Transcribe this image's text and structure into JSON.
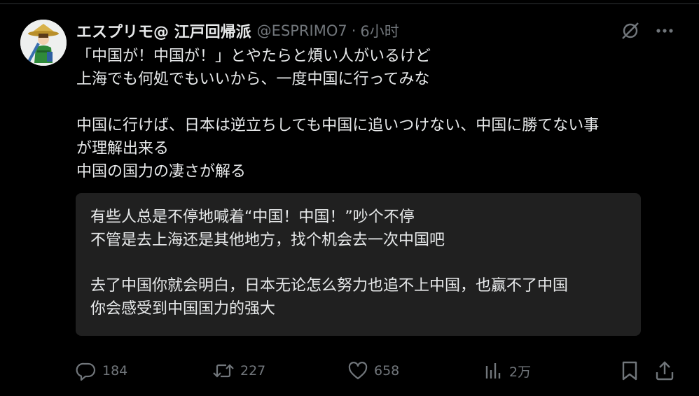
{
  "author": {
    "display_name": "エスプリモ@ 江戸回帰派",
    "handle": "@ESPRIMO7",
    "separator": "·",
    "time": "6小时"
  },
  "icons": {
    "grok": "grok-icon",
    "more": "more-dots-icon",
    "reply": "reply-icon",
    "retweet": "retweet-icon",
    "like": "heart-icon",
    "views": "views-bar-chart-icon",
    "bookmark": "bookmark-icon",
    "share": "share-icon"
  },
  "tweet": {
    "lines": [
      "「中国が！中国が！」とやたらと煩い人がいるけど",
      "上海でも何処でもいいから、一度中国に行ってみな",
      "中国に行けば、日本は逆立ちしても中国に追いつけない、中国に勝てない事",
      "が理解出来る",
      "中国の国力の凄さが解る"
    ]
  },
  "translation": {
    "lines": [
      "有些人总是不停地喊着“中国！中国！”吵个不停",
      "不管是去上海还是其他地方，找个机会去一次中国吧",
      "去了中国你就会明白，日本无论怎么努力也追不上中国，也赢不了中国",
      "你会感受到中国国力的强大"
    ]
  },
  "stats": {
    "replies": "184",
    "retweets": "227",
    "likes": "658",
    "views": "2万"
  },
  "colors": {
    "background": "#000000",
    "text": "#e7e9ea",
    "muted": "#71767b",
    "translation_bg": "#202020"
  }
}
